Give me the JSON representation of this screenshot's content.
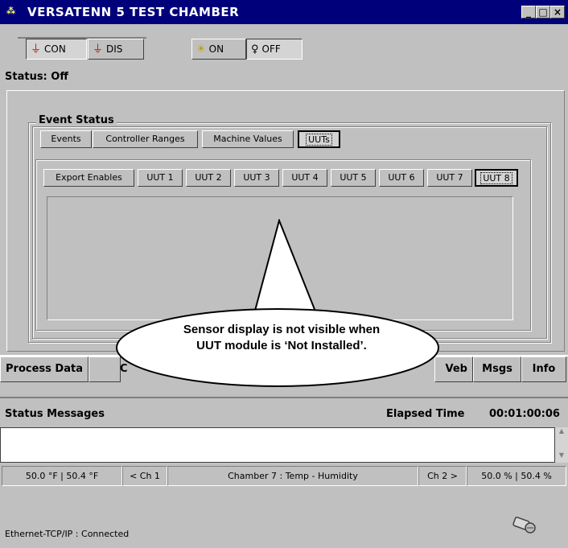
{
  "window": {
    "title": "VERSATENN 5 TEST CHAMBER",
    "controls": [
      "_",
      "□",
      "×"
    ]
  },
  "toolbar": {
    "con_label": "CON",
    "dis_label": "DIS",
    "on_label": "ON",
    "off_label": "OFF"
  },
  "status": {
    "label": "Status:",
    "value": "Off"
  },
  "event_status": {
    "group_title": "Event Status",
    "tabs": [
      "Events",
      "Controller Ranges",
      "Machine Values",
      "UUTs"
    ],
    "selected_tab": "UUTs",
    "uut_buttons": [
      "Export Enables",
      "UUT 1",
      "UUT 2",
      "UUT 3",
      "UUT 4",
      "UUT 5",
      "UUT 6",
      "UUT 7",
      "UUT 8"
    ],
    "selected_uut": "UUT 8"
  },
  "callout": {
    "text": "Sensor display is not visible when UUT module is ‘Not Installed’."
  },
  "bottom_tabs": {
    "left": "Process Data",
    "left_fragment": "C",
    "right": [
      "Web",
      "Msgs",
      "Info"
    ],
    "web_fragment": "Veb"
  },
  "messages": {
    "label": "Status Messages",
    "elapsed_label": "Elapsed Time",
    "elapsed_value": "00:01:00:06"
  },
  "statusbar": {
    "ch1_values": "50.0 °F  |  50.4 °F",
    "ch1_button": "< Ch 1",
    "chamber_name": "Chamber 7 : Temp - Humidity",
    "ch2_button": "Ch 2 >",
    "ch2_values": "50.0 %  |  50.4 %"
  },
  "connection": {
    "text": "Ethernet-TCP/IP : Connected"
  },
  "icons": [
    "app-icon",
    "plug-connect-icon",
    "plug-disconnect-icon",
    "bulb-on-icon",
    "bulb-off-icon",
    "network-plug-icon"
  ]
}
